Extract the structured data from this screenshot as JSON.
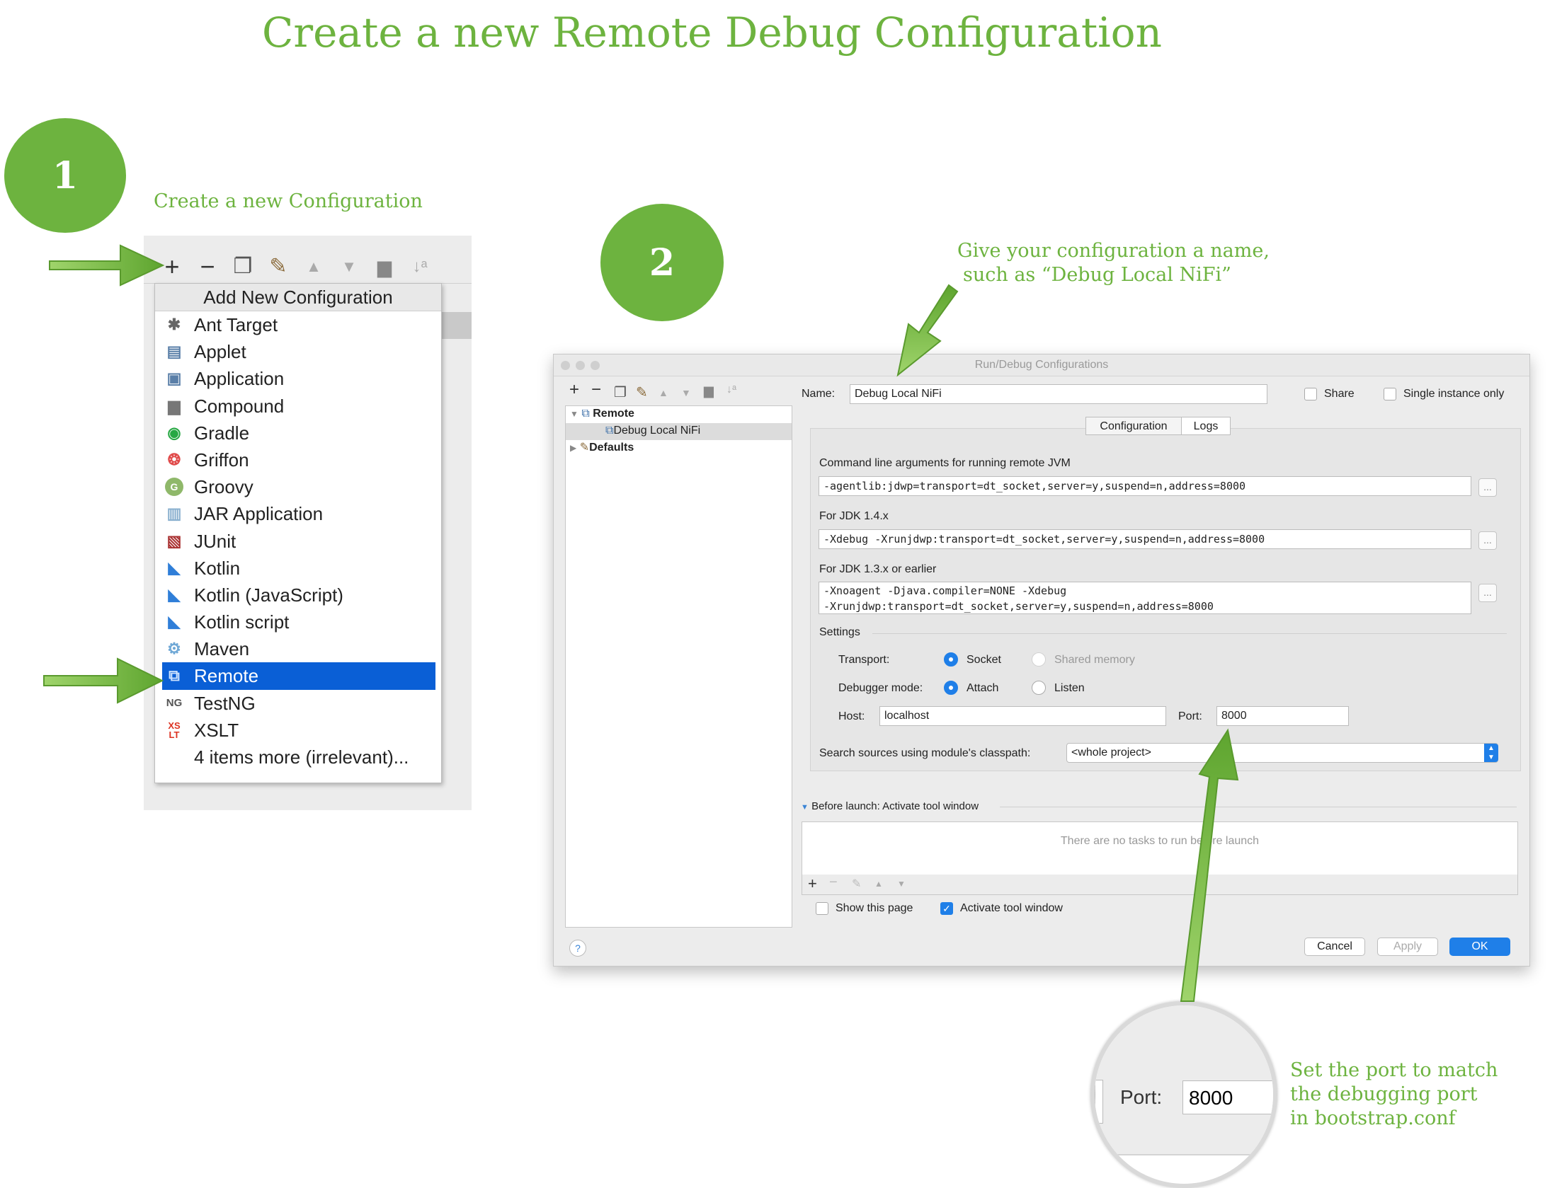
{
  "title": "Create a new Remote Debug Configuration",
  "steps": [
    {
      "number": "1",
      "caption": "Create a new Configuration"
    },
    {
      "number": "2",
      "caption_line1": "Give your configuration a name,",
      "caption_line2": "such as “Debug Local NiFi”"
    }
  ],
  "port_callout": {
    "line1": "Set the port to match",
    "line2": "the debugging port",
    "line3": "in bootstrap.conf"
  },
  "colors": {
    "accent_green": "#6db33f",
    "selection_blue": "#0a5fd6",
    "button_blue": "#1f7fe8"
  },
  "toolbar_icons": [
    "plus-icon",
    "minus-icon",
    "copy-icon",
    "wrench-icon",
    "arrow-up-icon",
    "arrow-down-icon",
    "folder-icon",
    "sort-icon"
  ],
  "add_menu": {
    "header": "Add New Configuration",
    "items": [
      {
        "label": "Ant Target",
        "icon": "ant-icon"
      },
      {
        "label": "Applet",
        "icon": "applet-icon"
      },
      {
        "label": "Application",
        "icon": "application-icon"
      },
      {
        "label": "Compound",
        "icon": "folder-icon"
      },
      {
        "label": "Gradle",
        "icon": "gradle-icon"
      },
      {
        "label": "Griffon",
        "icon": "griffon-icon"
      },
      {
        "label": "Groovy",
        "icon": "groovy-icon"
      },
      {
        "label": "JAR Application",
        "icon": "jar-icon"
      },
      {
        "label": "JUnit",
        "icon": "junit-icon"
      },
      {
        "label": "Kotlin",
        "icon": "kotlin-icon"
      },
      {
        "label": "Kotlin (JavaScript)",
        "icon": "kotlin-icon"
      },
      {
        "label": "Kotlin script",
        "icon": "kotlin-icon"
      },
      {
        "label": "Maven",
        "icon": "maven-icon"
      },
      {
        "label": "Remote",
        "icon": "remote-icon",
        "selected": true
      },
      {
        "label": "TestNG",
        "icon": "testng-icon"
      },
      {
        "label": "XSLT",
        "icon": "xslt-icon"
      },
      {
        "label": "4 items more (irrelevant)...",
        "icon": ""
      }
    ]
  },
  "dialog": {
    "title": "Run/Debug Configurations",
    "tree": {
      "remote": "Remote",
      "child": "Debug Local NiFi",
      "defaults": "Defaults"
    },
    "name_label": "Name:",
    "name_value": "Debug Local NiFi",
    "share_label": "Share",
    "single_instance_label": "Single instance only",
    "tabs": [
      "Configuration",
      "Logs"
    ],
    "cmd_label": "Command line arguments for running remote JVM",
    "cmd_value": "-agentlib:jdwp=transport=dt_socket,server=y,suspend=n,address=8000",
    "jdk14_label": "For JDK 1.4.x",
    "jdk14_value": "-Xdebug -Xrunjdwp:transport=dt_socket,server=y,suspend=n,address=8000",
    "jdk13_label": "For JDK 1.3.x or earlier",
    "jdk13_line1": "-Xnoagent -Djava.compiler=NONE -Xdebug",
    "jdk13_line2": "-Xrunjdwp:transport=dt_socket,server=y,suspend=n,address=8000",
    "dots": "...",
    "settings_label": "Settings",
    "transport_label": "Transport:",
    "socket_label": "Socket",
    "shared_memory_label": "Shared memory",
    "debugger_mode_label": "Debugger mode:",
    "attach_label": "Attach",
    "listen_label": "Listen",
    "host_label": "Host:",
    "host_value": "localhost",
    "port_label": "Port:",
    "port_value": "8000",
    "search_label": "Search sources using module's classpath:",
    "search_value": "<whole project>",
    "before_launch_label": "Before launch: Activate tool window",
    "no_tasks": "There are no tasks to run before launch",
    "show_page_label": "Show this page",
    "activate_label": "Activate tool window",
    "help": "?",
    "cancel": "Cancel",
    "apply": "Apply",
    "ok": "OK"
  },
  "zoom": {
    "port_label": "Port:",
    "port_value": "8000"
  }
}
